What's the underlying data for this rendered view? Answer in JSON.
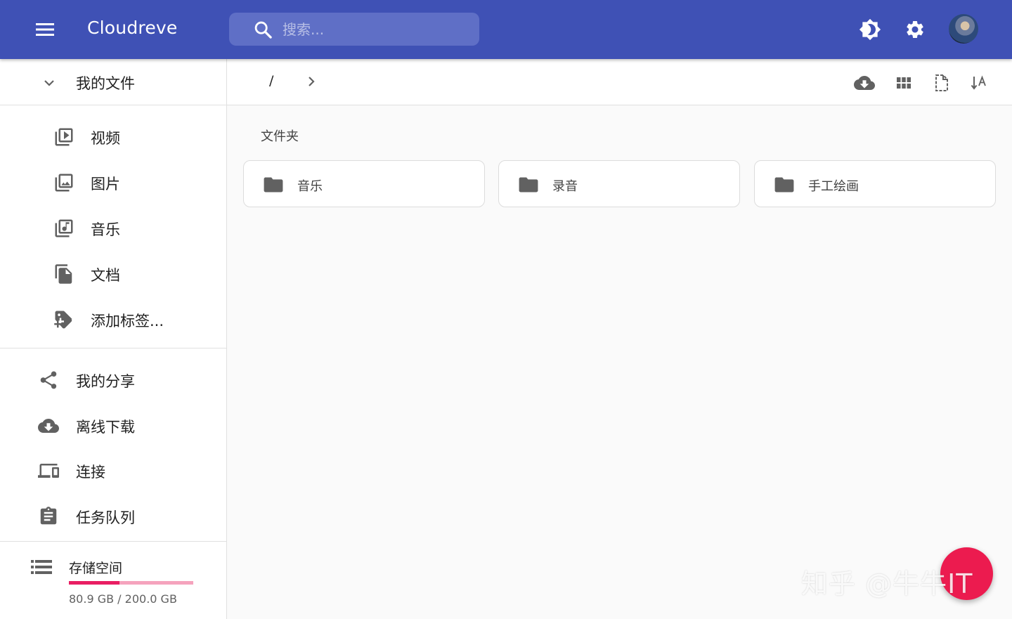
{
  "app": {
    "title": "Cloudreve"
  },
  "search": {
    "placeholder": "搜索..."
  },
  "header": {
    "menu_icon": "menu-icon",
    "theme_icon": "brightness-icon",
    "settings_icon": "gear-icon"
  },
  "sidebar": {
    "root_label": "我的文件",
    "sub_items": [
      {
        "label": "视频",
        "icon": "video-library-icon"
      },
      {
        "label": "图片",
        "icon": "photo-library-icon"
      },
      {
        "label": "音乐",
        "icon": "music-library-icon"
      },
      {
        "label": "文档",
        "icon": "file-copy-icon"
      },
      {
        "label": "添加标签...",
        "icon": "tag-add-icon"
      }
    ],
    "items": [
      {
        "label": "我的分享",
        "icon": "share-icon"
      },
      {
        "label": "离线下载",
        "icon": "cloud-download-icon"
      },
      {
        "label": "连接",
        "icon": "devices-icon"
      },
      {
        "label": "任务队列",
        "icon": "clipboard-icon"
      }
    ],
    "storage": {
      "label": "存储空间",
      "used_text": "80.9 GB / 200.0 GB",
      "used_fraction": 0.4045
    }
  },
  "toolbar": {
    "path_root": "/",
    "actions": [
      "cloud-download-icon",
      "grid-view-icon",
      "file-dashed-icon",
      "sort-alpha-icon"
    ]
  },
  "content": {
    "section_title": "文件夹",
    "folders": [
      {
        "name": "音乐"
      },
      {
        "name": "录音"
      },
      {
        "name": "手工绘画"
      }
    ]
  },
  "watermark": {
    "text": "知乎 @牛牛IT"
  },
  "colors": {
    "primary": "#3f51b5",
    "accent": "#e91e63",
    "fab": "#ec1b4f"
  }
}
